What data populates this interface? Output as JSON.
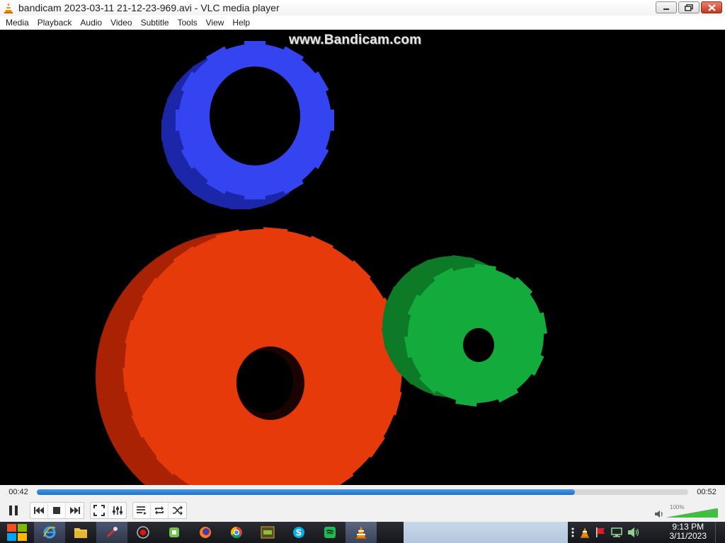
{
  "window": {
    "title": "bandicam 2023-03-11 21-12-23-969.avi - VLC media player",
    "icon": "vlc-cone-icon",
    "buttons": [
      "minimize-icon",
      "restore-icon",
      "close-icon"
    ]
  },
  "menu": {
    "items": [
      "Media",
      "Playback",
      "Audio",
      "Video",
      "Subtitle",
      "Tools",
      "View",
      "Help"
    ]
  },
  "video": {
    "watermark": "www.Bandicam.com",
    "background": "#000000",
    "gear_colors": {
      "blue": "#2f3fe6",
      "red": "#e23a0c",
      "green": "#12a93a"
    }
  },
  "seek": {
    "elapsed": "00:42",
    "total": "00:52",
    "progress": 0.826,
    "fill_color": "#2a7bd0"
  },
  "controls": {
    "play_state": "pause-icon",
    "buttons": [
      "previous-icon",
      "stop-icon",
      "next-icon",
      "fullscreen-icon",
      "extended-settings-icon",
      "playlist-icon",
      "loop-icon",
      "shuffle-icon"
    ]
  },
  "volume": {
    "percent_label": "100%",
    "level": 1.0,
    "fill_color": "#3fbf3f"
  },
  "taskbar": {
    "apps": [
      "start-icon",
      "internet-explorer-icon",
      "file-explorer-icon",
      "paint-icon",
      "bandicam-icon",
      "cpu-icon",
      "firefox-icon",
      "chrome-icon",
      "game-icon",
      "skype-icon",
      "spotify-icon",
      "vlc-icon"
    ],
    "active_app": "vlc-icon",
    "tray_icons": [
      "overflow-icon",
      "vlc-tray-icon",
      "flag-icon",
      "network-icon",
      "speaker-icon"
    ],
    "clock": {
      "time": "9:13 PM",
      "date": "3/11/2023"
    }
  }
}
